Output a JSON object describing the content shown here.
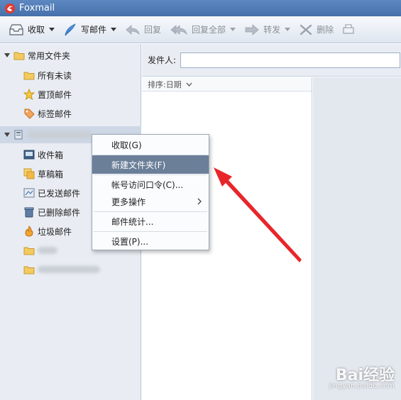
{
  "window": {
    "title": "Foxmail"
  },
  "toolbar": {
    "receive_label": "收取",
    "compose_label": "写邮件",
    "reply_label": "回复",
    "reply_all_label": "回复全部",
    "forward_label": "转发",
    "delete_label": "删除"
  },
  "sidebar": {
    "common_folders_label": "常用文件夹",
    "common_items": [
      "所有未读",
      "置顶邮件",
      "标签邮件"
    ],
    "account_items": [
      "收件箱",
      "草稿箱",
      "已发送邮件",
      "已删除邮件",
      "垃圾邮件"
    ]
  },
  "search": {
    "sender_label": "发件人:",
    "value": ""
  },
  "list": {
    "sort_label": "排序:日期"
  },
  "context_menu": {
    "items": [
      "收取(G)",
      "新建文件夹(F)",
      "帐号访问口令(C)...",
      "更多操作",
      "邮件统计...",
      "设置(P)..."
    ],
    "highlighted_index": 1
  },
  "watermark": {
    "text": "Bai经验",
    "sub": "jingyan.baidu.com"
  },
  "colors": {
    "accent": "#4670ab",
    "highlight": "#6b7f99",
    "annotation_arrow": "#e8262a"
  }
}
